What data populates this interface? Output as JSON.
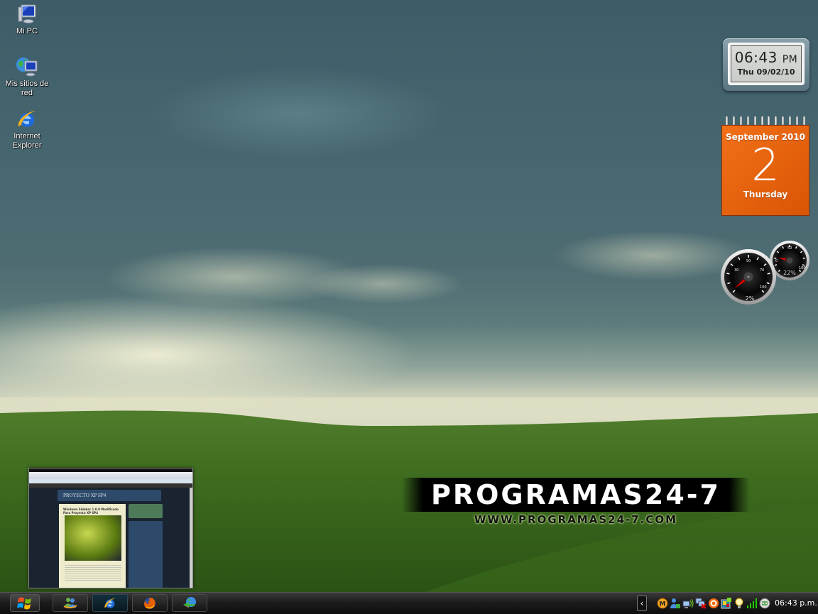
{
  "desktop": {
    "icons": [
      {
        "label": "Mi PC",
        "icon": "my-computer-icon"
      },
      {
        "label": "Mis sitios de red",
        "icon": "network-places-icon"
      },
      {
        "label": "Internet Explorer",
        "icon": "internet-explorer-icon"
      }
    ],
    "watermark": {
      "title": "PROGRAMAS24-7",
      "url": "WWW.PROGRAMAS24-7.COM"
    }
  },
  "gadgets": {
    "clock": {
      "time": "06:43",
      "ampm": "PM",
      "date": "Thu 09/02/10"
    },
    "calendar": {
      "month_year": "September 2010",
      "day": "2",
      "weekday": "Thursday",
      "color": "#e8600c"
    },
    "cpu_meter": {
      "cpu_percent": 2,
      "cpu_label": "2%",
      "memory_percent": 22,
      "memory_label": "22%",
      "big_ticks": [
        "30",
        "50",
        "70",
        "100"
      ],
      "small_ticks": [
        "0",
        "50",
        "100"
      ]
    }
  },
  "taskbar": {
    "start_icon": "windows-logo-icon",
    "buttons": [
      {
        "name": "messenger",
        "icon": "windows-live-messenger-icon",
        "active": false
      },
      {
        "name": "internet-explorer",
        "icon": "internet-explorer-icon",
        "active": true
      },
      {
        "name": "firefox",
        "icon": "firefox-icon",
        "active": false
      },
      {
        "name": "download-manager",
        "icon": "download-manager-icon",
        "active": false
      }
    ],
    "preview": {
      "blog_title": "PROYECTO XP SP4",
      "post_title": "Windows Sidebar 1.0.0 Modificado Para Proyecto XP SP4"
    },
    "tray": {
      "expand_label": "‹",
      "icons": [
        "messenger-m-icon",
        "user-status-icon",
        "wireless-network-icon",
        "network-disconnected-icon",
        "avast-icon",
        "window-app-icon",
        "lightbulb-icon",
        "signal-strength-icon",
        "robot-icon"
      ],
      "clock": "06:43 p.m."
    }
  }
}
